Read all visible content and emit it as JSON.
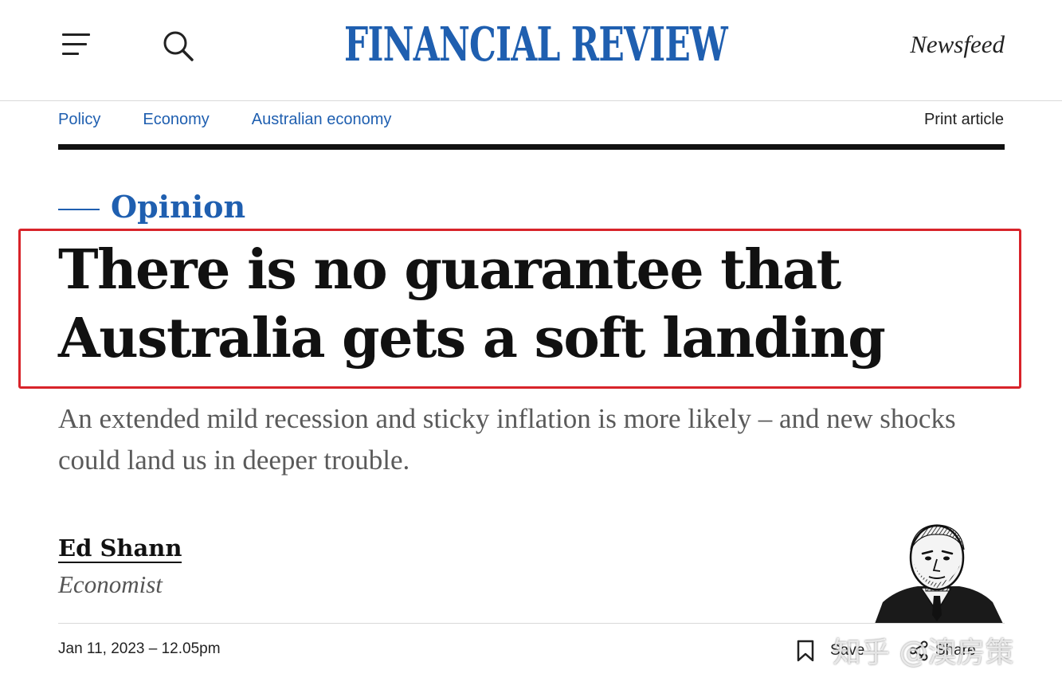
{
  "header": {
    "logo": "FINANCIAL REVIEW",
    "newsfeed": "Newsfeed",
    "brand_color": "#1f5fb0"
  },
  "breadcrumbs": [
    "Policy",
    "Economy",
    "Australian economy"
  ],
  "print_label": "Print article",
  "article": {
    "section": "Opinion",
    "headline": "There is no guarantee that Australia gets a soft landing",
    "standfirst": "An extended mild recession and sticky inflation is more likely – and new shocks could land us in deeper trouble.",
    "author": "Ed Shann",
    "author_role": "Economist",
    "date": "Jan 11, 2023 – 12.05pm"
  },
  "actions": {
    "save_label": "Save",
    "share_label": "Share"
  },
  "watermark": "知乎 @澳房策",
  "icons": [
    "menu-icon",
    "search-icon",
    "bookmark-icon",
    "share-icon"
  ],
  "highlight_color": "#d8232a"
}
